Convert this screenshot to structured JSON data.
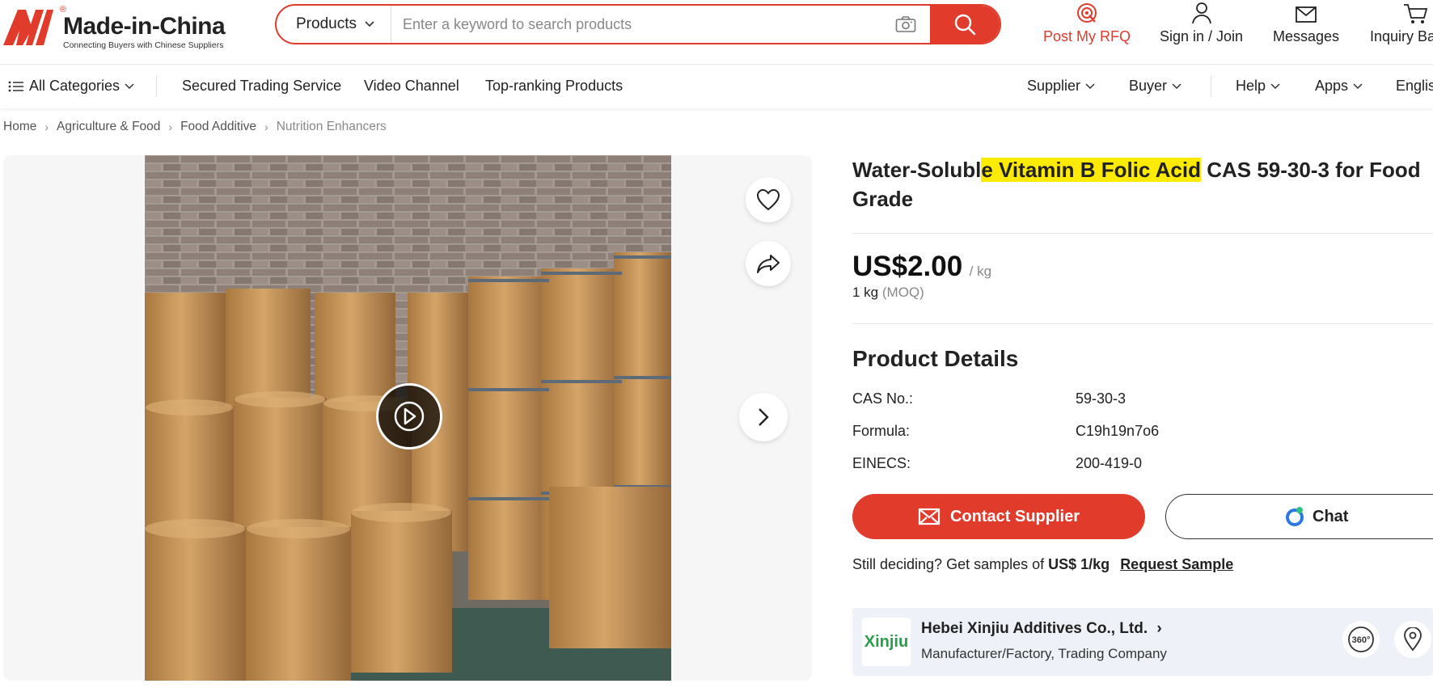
{
  "brand": {
    "name": "Made-in-China",
    "tagline": "Connecting Buyers with Chinese Suppliers",
    "reg_mark": "®"
  },
  "search": {
    "category": "Products",
    "placeholder": "Enter a keyword to search products"
  },
  "header_nav": {
    "post_rfq": "Post My RFQ",
    "sign_in": "Sign in / Join",
    "messages": "Messages",
    "inquiry": "Inquiry Ba"
  },
  "nav": {
    "all_categories": "All Categories",
    "secured": "Secured Trading Service",
    "video": "Video Channel",
    "top_ranking": "Top-ranking Products",
    "supplier": "Supplier",
    "buyer": "Buyer",
    "help": "Help",
    "apps": "Apps",
    "language": "Englis"
  },
  "breadcrumb": [
    "Home",
    "Agriculture & Food",
    "Food Additive",
    "Nutrition Enhancers"
  ],
  "product": {
    "title_pre": "Water-Solubl",
    "title_hl": "e Vitamin B Folic Acid",
    "title_post": " CAS 59-30-3 for Food Grade",
    "price": "US$2.00",
    "price_unit": "/ kg",
    "moq_value": "1 kg",
    "moq_label": "(MOQ)",
    "details_heading": "Product Details",
    "specs": [
      {
        "label": "CAS No.:",
        "value": "59-30-3"
      },
      {
        "label": "Formula:",
        "value": "C19h19n7o6"
      },
      {
        "label": "EINECS:",
        "value": "200-419-0"
      }
    ],
    "contact_label": "Contact Supplier",
    "chat_label": "Chat",
    "sample_prefix": "Still deciding? Get samples of ",
    "sample_price": "US$ 1/kg",
    "sample_link": "Request Sample"
  },
  "supplier": {
    "logo_text": "Xinjiu",
    "name": "Hebei Xinjiu Additives Co., Ltd.",
    "type": "Manufacturer/Factory, Trading Company",
    "tour_label": "360°"
  },
  "colors": {
    "accent": "#e03b2b",
    "highlight": "#ffeb00",
    "supplier_bg": "#eef2f8"
  }
}
